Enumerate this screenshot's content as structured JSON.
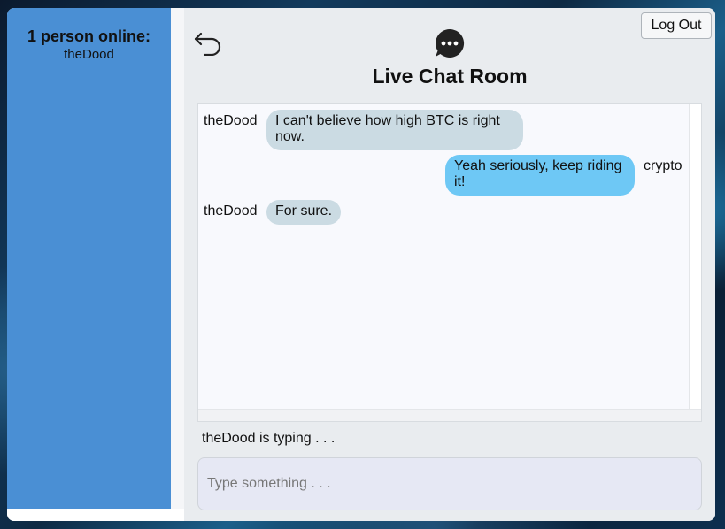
{
  "sidebar": {
    "online_count": "1 person online:",
    "users": [
      "theDood"
    ]
  },
  "header": {
    "title": "Live Chat Room",
    "logout_label": "Log Out",
    "back_icon": "undo-arrow-icon",
    "chat_icon": "chat-bubble-icon"
  },
  "messages": [
    {
      "sender": "theDood",
      "text": "I can't believe how high BTC is right now.",
      "direction": "incoming"
    },
    {
      "sender": "crypto",
      "text": "Yeah seriously, keep riding it!",
      "direction": "outgoing"
    },
    {
      "sender": "theDood",
      "text": "For sure.",
      "direction": "incoming"
    }
  ],
  "status": {
    "typing": "theDood is typing . . ."
  },
  "composer": {
    "placeholder": "Type something . . ."
  },
  "colors": {
    "sidebar": "#4a8fd4",
    "incoming_bubble": "#cbdbe3",
    "outgoing_bubble": "#6ec8f5"
  }
}
